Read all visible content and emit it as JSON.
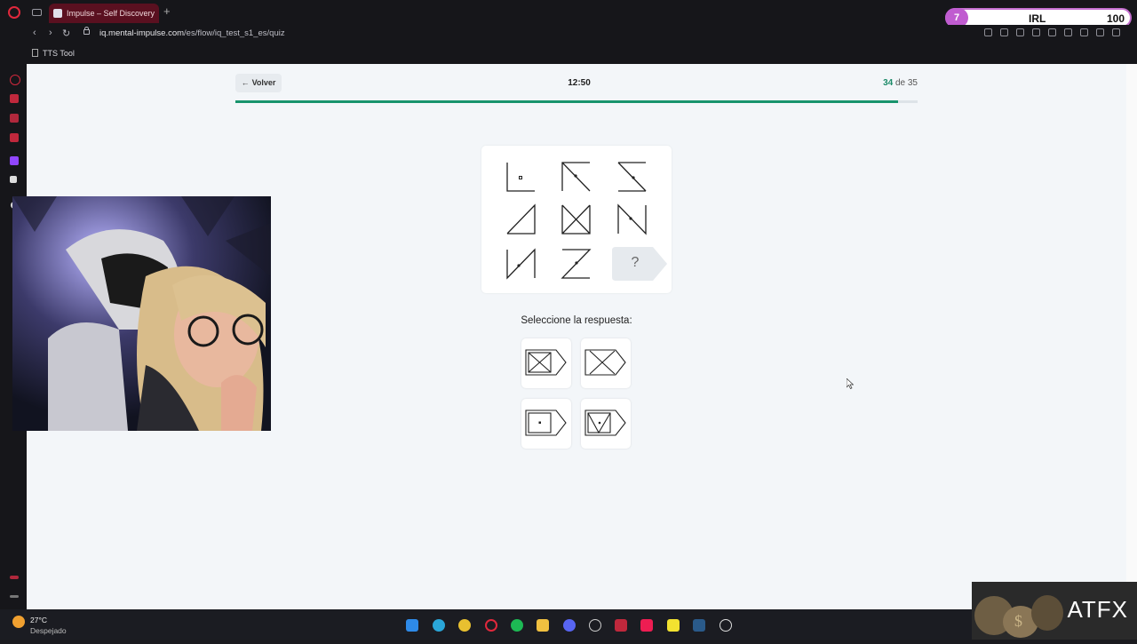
{
  "browser": {
    "tab_title": "Impulse – Self Discovery",
    "new_tab": "+",
    "url_host": "iq.mental-impulse.com",
    "url_path": "/es/flow/iq_test_s1_es/quiz",
    "bookmark": "TTS Tool",
    "back_nav": "‹",
    "forward_nav": "›",
    "reload": "↻"
  },
  "overlay": {
    "level": "7",
    "label": "IRL",
    "score": "100",
    "logo": "ATFX"
  },
  "quiz": {
    "back_label": "Volver",
    "back_arrow": "←",
    "timer": "12:50",
    "current": "34",
    "of_label": "de 35",
    "progress": 0.971,
    "question_mark": "?",
    "prompt": "Seleccione la respuesta:"
  },
  "taskbar": {
    "temp": "27°C",
    "weather": "Despejado"
  },
  "colors": {
    "accent": "#18946d",
    "tab": "#5a1020",
    "opera": "#e0283c"
  }
}
